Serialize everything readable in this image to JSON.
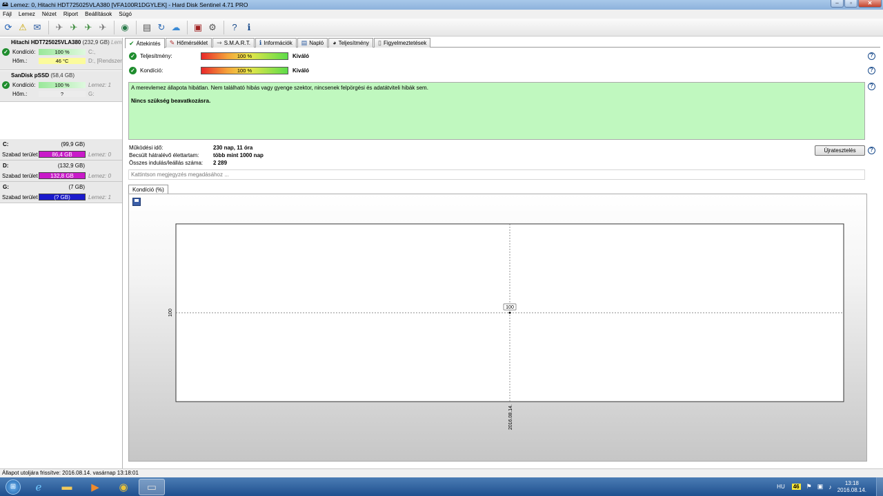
{
  "window": {
    "title": "Lemez: 0, Hitachi HDT725025VLA380 [VFA100R1DGYLEK]  -  Hard Disk Sentinel 4.71 PRO"
  },
  "menu": [
    "Fájl",
    "Lemez",
    "Nézet",
    "Riport",
    "Beállítások",
    "Súgó"
  ],
  "disks": [
    {
      "name": "Hitachi HDT725025VLA380",
      "size": "(232,9 GB)",
      "tag": "Lemez",
      "kond_label": "Kondíció:",
      "kond": "100 %",
      "kond_aux": "C:,",
      "hom_label": "Hőm.:",
      "hom": "46 °C",
      "hom_aux": "D:, [Rendszer"
    },
    {
      "name": "SanDisk pSSD",
      "size": "(58,4 GB)",
      "kond_label": "Kondíció:",
      "kond": "100 %",
      "kond_aux": "Lemez: 1",
      "hom_label": "Hőm.:",
      "hom": "?",
      "hom_aux": "G:"
    }
  ],
  "partitions": [
    {
      "letter": "C:",
      "size": "(99,9 GB)",
      "free_label": "Szabad terület",
      "free": "86,4 GB",
      "disk": "Lemez: 0",
      "color": "#c91ac9"
    },
    {
      "letter": "D:",
      "size": "(132,9 GB)",
      "free_label": "Szabad terület",
      "free": "132,8 GB",
      "disk": "Lemez: 0",
      "color": "#c91ac9"
    },
    {
      "letter": "G:",
      "size": "(7 GB)",
      "free_label": "Szabad terület",
      "free": "(? GB)",
      "disk": "Lemez: 1",
      "color": "#1a1acc"
    }
  ],
  "tabs": [
    "Áttekintés",
    "Hőmérséklet",
    "S.M.A.R.T.",
    "Információk",
    "Napló",
    "Teljesítmény",
    "Figyelmeztetések"
  ],
  "overview": {
    "perf_label": "Teljesítmény:",
    "perf": "100 %",
    "perf_value": 100,
    "perf_text": "Kiváló",
    "kond_label": "Kondíció:",
    "kond": "100 %",
    "kond_value": 100,
    "kond_text": "Kiváló",
    "status_line": "A merevlemez állapota hibátlan. Nem található hibás vagy gyenge szektor, nincsenek felpörgési és adatátviteli hibák sem.",
    "status_bold": "Nincs szükség beavatkozásra.",
    "uptime_label": "Működési idő:",
    "uptime": "230 nap, 11 óra",
    "life_label": "Becsült hátralévő élettartam:",
    "life": "több mint 1000 nap",
    "starts_label": "Összes indulás/leállás száma:",
    "starts": "2 289",
    "retest": "Újratesztelés",
    "note_placeholder": "Kattintson megjegyzés megadásához ..."
  },
  "chart_tab": "Kondíció  (%)",
  "chart_data": {
    "type": "line",
    "x": [
      "2016.08.14."
    ],
    "series": [
      {
        "values": [
          100
        ]
      }
    ],
    "ylabel_tick": "100",
    "point_label": "100",
    "grid": false
  },
  "status": "Állapot utoljára frissítve: 2016.08.14. vasárnap 13:18:01",
  "taskbar": {
    "lang": "HU",
    "temp": "46",
    "time": "13:18",
    "date": "2016.08.14."
  }
}
